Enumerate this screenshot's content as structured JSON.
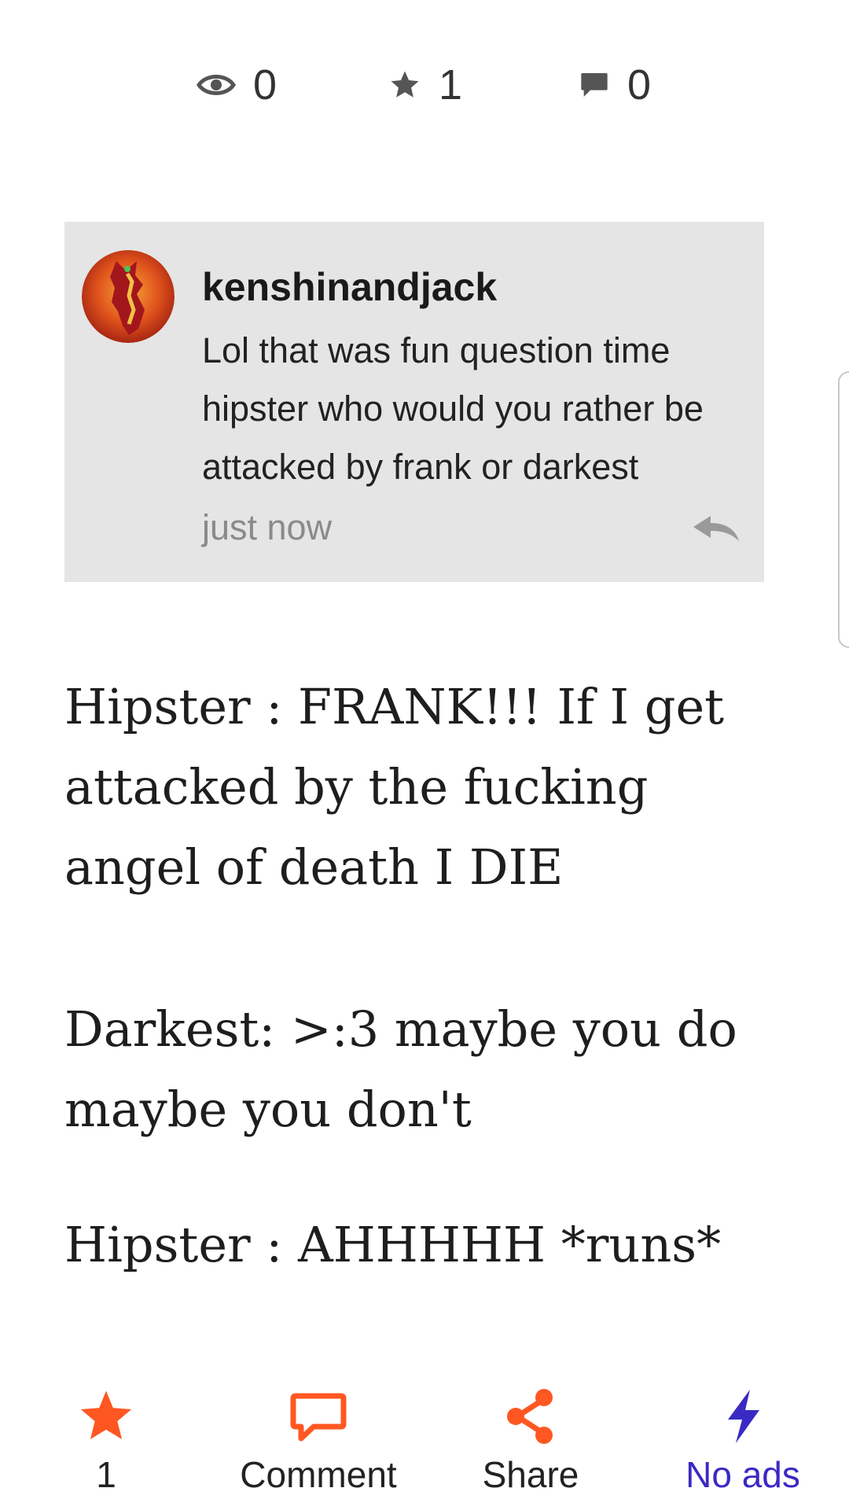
{
  "stats": {
    "views": "0",
    "stars": "1",
    "comments": "0"
  },
  "comment": {
    "author": "kenshinandjack",
    "text": "Lol that was fun question time hipster who would you rather be attacked by frank or darkest",
    "time": "just now"
  },
  "story": {
    "paragraphs": [
      "Hipster : FRANK!!! If I get attacked by the fucking angel of death I DIE",
      "Darkest: >:3 maybe you do maybe you don't",
      "Hipster : AHHHHH *runs*"
    ]
  },
  "actions": {
    "vote_count": "1",
    "comment_label": "Comment",
    "share_label": "Share",
    "no_ads_label": "No ads"
  },
  "icons": {
    "views": "eye-icon",
    "stars": "star-icon",
    "comments": "speech-bubble-icon",
    "reply": "reply-arrow-icon",
    "vote": "star-icon",
    "comment": "speech-bubble-icon",
    "share": "share-icon",
    "no_ads": "lightning-bolt-icon"
  },
  "colors": {
    "accent_orange": "#ff5722",
    "no_ads_purple": "#3a2ac4",
    "card_background": "#e5e5e5",
    "stat_icon_gray": "#555555"
  }
}
